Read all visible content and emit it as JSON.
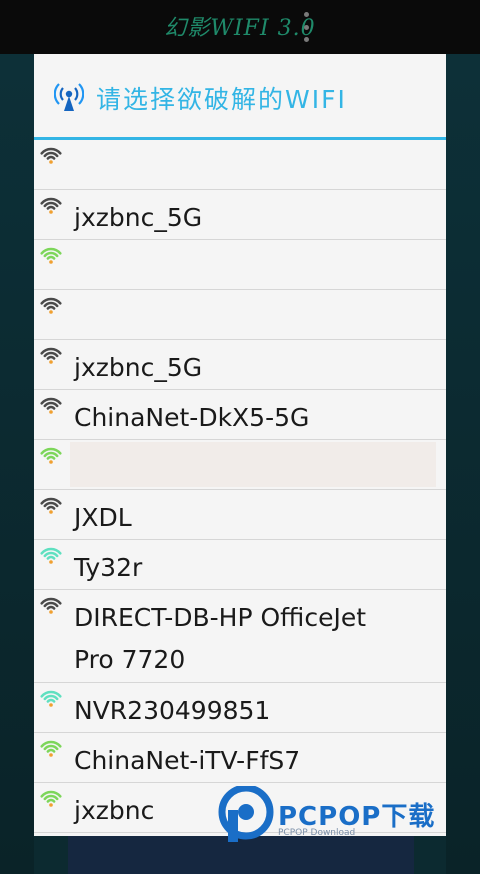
{
  "app": {
    "title": "幻影WIFI 3.0"
  },
  "dialog": {
    "title": "请选择欲破解的WIFI"
  },
  "colors": {
    "accent": "#33b5e5",
    "signal_gray": "#4a4a4a",
    "signal_green": "#7dd65a",
    "signal_teal": "#5fe0c0",
    "dot_orange": "#f0a030",
    "watermark_blue": "#1a6ec7"
  },
  "networks": [
    {
      "ssid": "",
      "signal": "gray"
    },
    {
      "ssid": "jxzbnc_5G",
      "signal": "gray"
    },
    {
      "ssid": "",
      "signal": "green"
    },
    {
      "ssid": "",
      "signal": "gray"
    },
    {
      "ssid": "jxzbnc_5G",
      "signal": "gray"
    },
    {
      "ssid": "ChinaNet-DkX5-5G",
      "signal": "gray"
    },
    {
      "ssid": "",
      "signal": "green",
      "highlighted": true
    },
    {
      "ssid": "JXDL",
      "signal": "gray"
    },
    {
      "ssid": "Ty32r",
      "signal": "teal"
    },
    {
      "ssid": "DIRECT-DB-HP OfficeJet\nPro 7720",
      "signal": "gray"
    },
    {
      "ssid": "NVR230499851",
      "signal": "teal"
    },
    {
      "ssid": "ChinaNet-iTV-FfS7",
      "signal": "green"
    },
    {
      "ssid": "jxzbnc",
      "signal": "green"
    }
  ],
  "watermark": {
    "brand": "PCPOP下载",
    "sub": "PCPOP Download"
  }
}
